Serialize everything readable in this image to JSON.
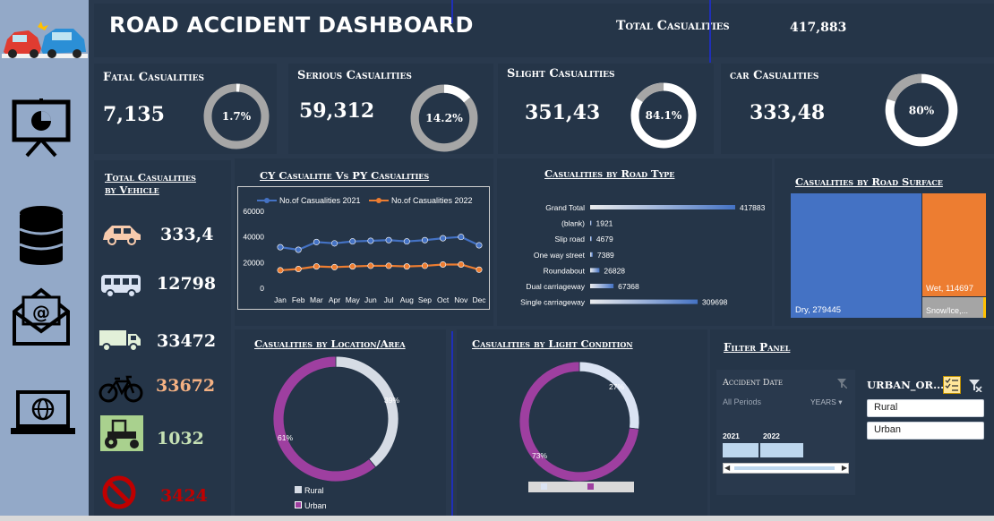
{
  "header": {
    "title": "ROAD ACCIDENT DASHBOARD",
    "total_label": "Total Casualities",
    "total_value": "417,883"
  },
  "kpis": [
    {
      "label": "Fatal Casualities",
      "value": "7,135",
      "pct_label": "1.7%",
      "pct": 1.7
    },
    {
      "label": "Serious Casualities",
      "value": "59,312",
      "pct_label": "14.2%",
      "pct": 14.2
    },
    {
      "label": "Slight Casualities",
      "value": "351,43",
      "pct_label": "84.1%",
      "pct": 84.1
    },
    {
      "label": "car Casualities",
      "value": "333,48",
      "pct_label": "80%",
      "pct": 80
    }
  ],
  "vehicle_panel": {
    "title": "Total Casualities by Vehicle",
    "items": [
      {
        "icon": "car-icon",
        "value": "333,4",
        "color": "#ffffff"
      },
      {
        "icon": "bus-icon",
        "value": "12798",
        "color": "#ffffff"
      },
      {
        "icon": "truck-icon",
        "value": "33472",
        "color": "#ffffff"
      },
      {
        "icon": "bicycle-icon",
        "value": "33672",
        "color": "#f4b183"
      },
      {
        "icon": "tractor-icon",
        "value": "1032",
        "color": "#c5e0b4"
      },
      {
        "icon": "no-entry-icon",
        "value": "3424",
        "color": "#c00000"
      }
    ]
  },
  "line_chart": {
    "title": "CY Casualitie Vs PY Casualities"
  },
  "road_chart": {
    "title": "Casualities by Road Type"
  },
  "surface_chart": {
    "title": "Casualities by Road Surface",
    "items": [
      {
        "label": "Dry, 279445",
        "value": 279445,
        "color": "#4472c4"
      },
      {
        "label": "Wet, 114697",
        "value": 114697,
        "color": "#ed7d31"
      },
      {
        "label": "Snow/Ice,...",
        "value": 18517,
        "color": "#a5a5a5"
      },
      {
        "label": "",
        "value": 5224,
        "color": "#ffc000"
      }
    ]
  },
  "location_chart": {
    "title": "Casualities by Location/Area"
  },
  "light_chart": {
    "title": "Casualities by Light Condition"
  },
  "filter_panel": {
    "title": "Filter Panel",
    "date_label": "Accident Date",
    "periods_label": "All Periods",
    "years_label": "YEARS",
    "year_2021": "2021",
    "year_2022": "2022",
    "urban_label": "URBAN_OR...",
    "options": [
      "Rural",
      "Urban"
    ]
  },
  "chart_data": [
    {
      "type": "line",
      "title": "CY Casualitie Vs PY Casualities",
      "categories": [
        "Jan",
        "Feb",
        "Mar",
        "Apr",
        "May",
        "Jun",
        "Jul",
        "Aug",
        "Sep",
        "Oct",
        "Nov",
        "Dec"
      ],
      "series": [
        {
          "name": "No.of Casualities 2021",
          "color": "#4472c4",
          "values": [
            32000,
            30000,
            36000,
            35000,
            36500,
            37000,
            37500,
            36500,
            37500,
            39000,
            40000,
            33500
          ]
        },
        {
          "name": "No.of Casualities 2022",
          "color": "#ed7d31",
          "values": [
            14000,
            15000,
            17000,
            16500,
            17000,
            17500,
            17500,
            17000,
            17500,
            18500,
            18500,
            14500
          ]
        }
      ],
      "yticks": [
        "0",
        "20000",
        "40000",
        "60000"
      ],
      "ylim": [
        0,
        60000
      ]
    },
    {
      "type": "bar",
      "title": "Casualities by Road Type",
      "categories": [
        "Grand Total",
        "(blank)",
        "Slip road",
        "One way street",
        "Roundabout",
        "Dual carriageway",
        "Single carriageway"
      ],
      "values": [
        417883,
        1921,
        4679,
        7389,
        26828,
        67368,
        309698
      ],
      "value_labels": [
        "417883",
        "1921",
        "4679",
        "7389",
        "26828",
        "67368",
        "309698"
      ],
      "color": "#4472c4"
    },
    {
      "type": "pie",
      "title": "Casualities by Location/Area",
      "series": [
        {
          "name": "Rural",
          "value": 39,
          "label": "39%",
          "color": "#d6dce5"
        },
        {
          "name": "Urban",
          "value": 61,
          "label": "61%",
          "color": "#9e3fa0"
        }
      ],
      "legend": [
        "Rural",
        "Urban"
      ]
    },
    {
      "type": "pie",
      "title": "Casualities by Light Condition",
      "series": [
        {
          "name": "",
          "value": 27,
          "label": "27%",
          "color": "#dae3f3"
        },
        {
          "name": "",
          "value": 73,
          "label": "73%",
          "color": "#9e3fa0"
        }
      ]
    }
  ]
}
